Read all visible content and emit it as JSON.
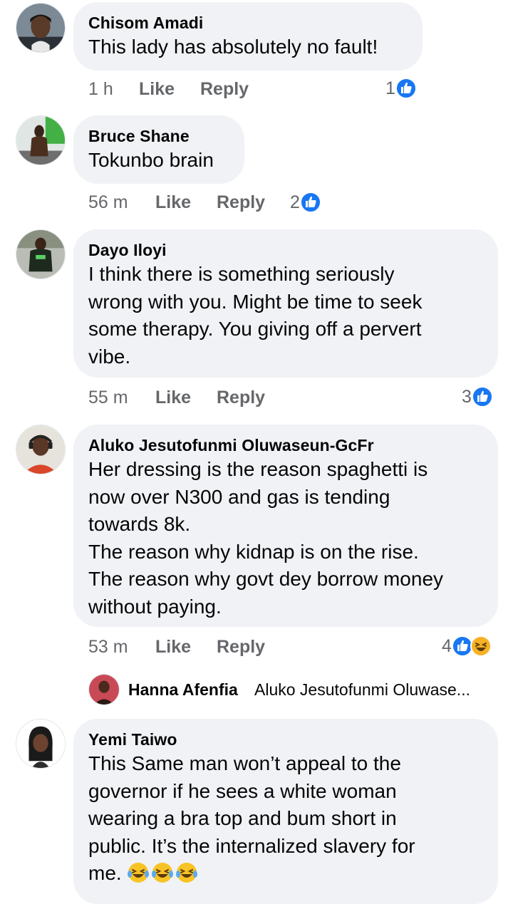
{
  "comments": [
    {
      "author": "Chisom Amadi",
      "lines": [
        "This lady has absolutely no fault!"
      ],
      "time": "1 h",
      "like_label": "Like",
      "reply_label": "Reply",
      "reaction_count": "1",
      "reaction_icons": [
        "like-icon"
      ]
    },
    {
      "author": "Bruce Shane",
      "lines": [
        "Tokunbo brain"
      ],
      "time": "56 m",
      "like_label": "Like",
      "reply_label": "Reply",
      "reaction_count": "2",
      "reaction_icons": [
        "like-icon"
      ]
    },
    {
      "author": "Dayo Iloyi",
      "lines": [
        "I think there is something seriously",
        "wrong with you. Might be time to seek",
        "some therapy. You giving off a pervert",
        "vibe."
      ],
      "time": "55 m",
      "like_label": "Like",
      "reply_label": "Reply",
      "reaction_count": "3",
      "reaction_icons": [
        "like-icon"
      ]
    },
    {
      "author": "Aluko Jesutofunmi Oluwaseun-GcFr",
      "lines": [
        "Her dressing is the reason spaghetti is",
        "now over N300 and gas is tending",
        "towards 8k.",
        "The reason why kidnap is on the rise.",
        "The reason why govt dey borrow money",
        "without paying."
      ],
      "time": "53 m",
      "like_label": "Like",
      "reply_label": "Reply",
      "reaction_count": "4",
      "reaction_icons": [
        "like-icon",
        "haha-icon"
      ]
    },
    {
      "author": "Yemi Taiwo",
      "lines": [
        "This Same man won’t appeal to the",
        "governor if he sees a white woman",
        "wearing a bra top and bum short in",
        "public. It’s the internalized slavery for",
        "me."
      ],
      "trailing_emoji": [
        "tears-of-joy-emoji",
        "tears-of-joy-emoji",
        "tears-of-joy-emoji"
      ]
    }
  ],
  "reply_preview": {
    "author": "Hanna Afenfia",
    "text": "Aluko Jesutofunmi Oluwase..."
  },
  "colors": {
    "bubble": "#f0f2f5",
    "meta_text": "#65676b",
    "like_blue": "#1877f2",
    "haha_yellow": "#f7b125"
  }
}
